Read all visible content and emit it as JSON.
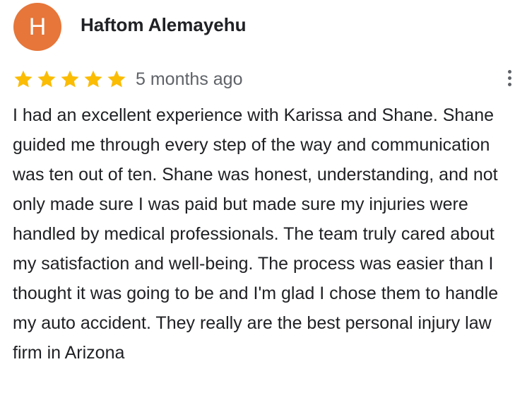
{
  "reviewer": {
    "initial": "H",
    "name": "Haftom Alemayehu",
    "avatar_color": "#e6763a"
  },
  "rating": {
    "stars": 5,
    "max_stars": 5,
    "star_color": "#fbbc04",
    "icon": "star-icon"
  },
  "date": "5 months ago",
  "more_options_icon": "more-vert-icon",
  "review_text": "I had an excellent experience with Karissa and Shane. Shane guided me through every step of the way and communication was ten out of ten. Shane was honest, understanding, and not only made sure I was paid but made sure my injuries were handled by medical professionals. The team truly cared about my satisfaction and well-being. The process was easier than I thought it was going to be and I'm glad I chose them to handle my auto accident. They really are the best personal injury law firm in Arizona"
}
